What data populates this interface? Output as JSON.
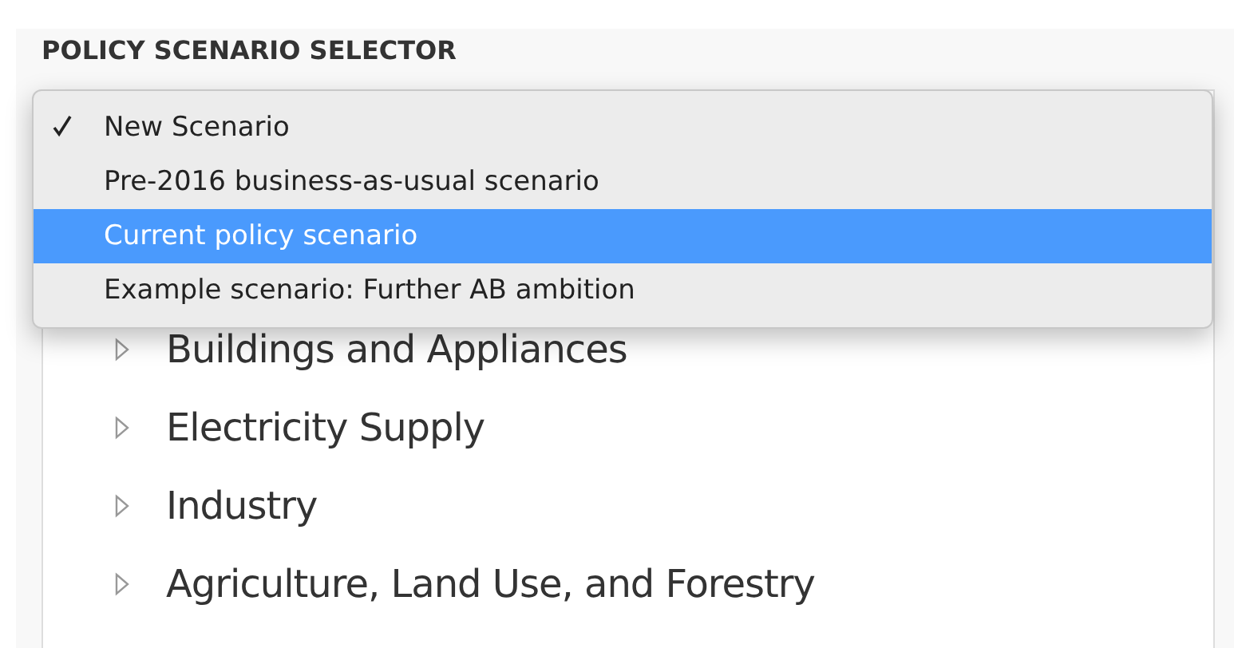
{
  "title": "POLICY SCENARIO SELECTOR",
  "scenario_menu": [
    {
      "label": "New Scenario",
      "checked": true,
      "selected": false
    },
    {
      "label": "Pre-2016 business-as-usual scenario",
      "checked": false,
      "selected": false
    },
    {
      "label": "Current policy scenario",
      "checked": false,
      "selected": true
    },
    {
      "label": "Example scenario: Further AB ambition",
      "checked": false,
      "selected": false
    }
  ],
  "sectors": [
    {
      "label": "Buildings and Appliances",
      "expanded": false
    },
    {
      "label": "Electricity Supply",
      "expanded": false
    },
    {
      "label": "Industry",
      "expanded": false
    },
    {
      "label": "Agriculture, Land Use, and Forestry",
      "expanded": false
    }
  ]
}
